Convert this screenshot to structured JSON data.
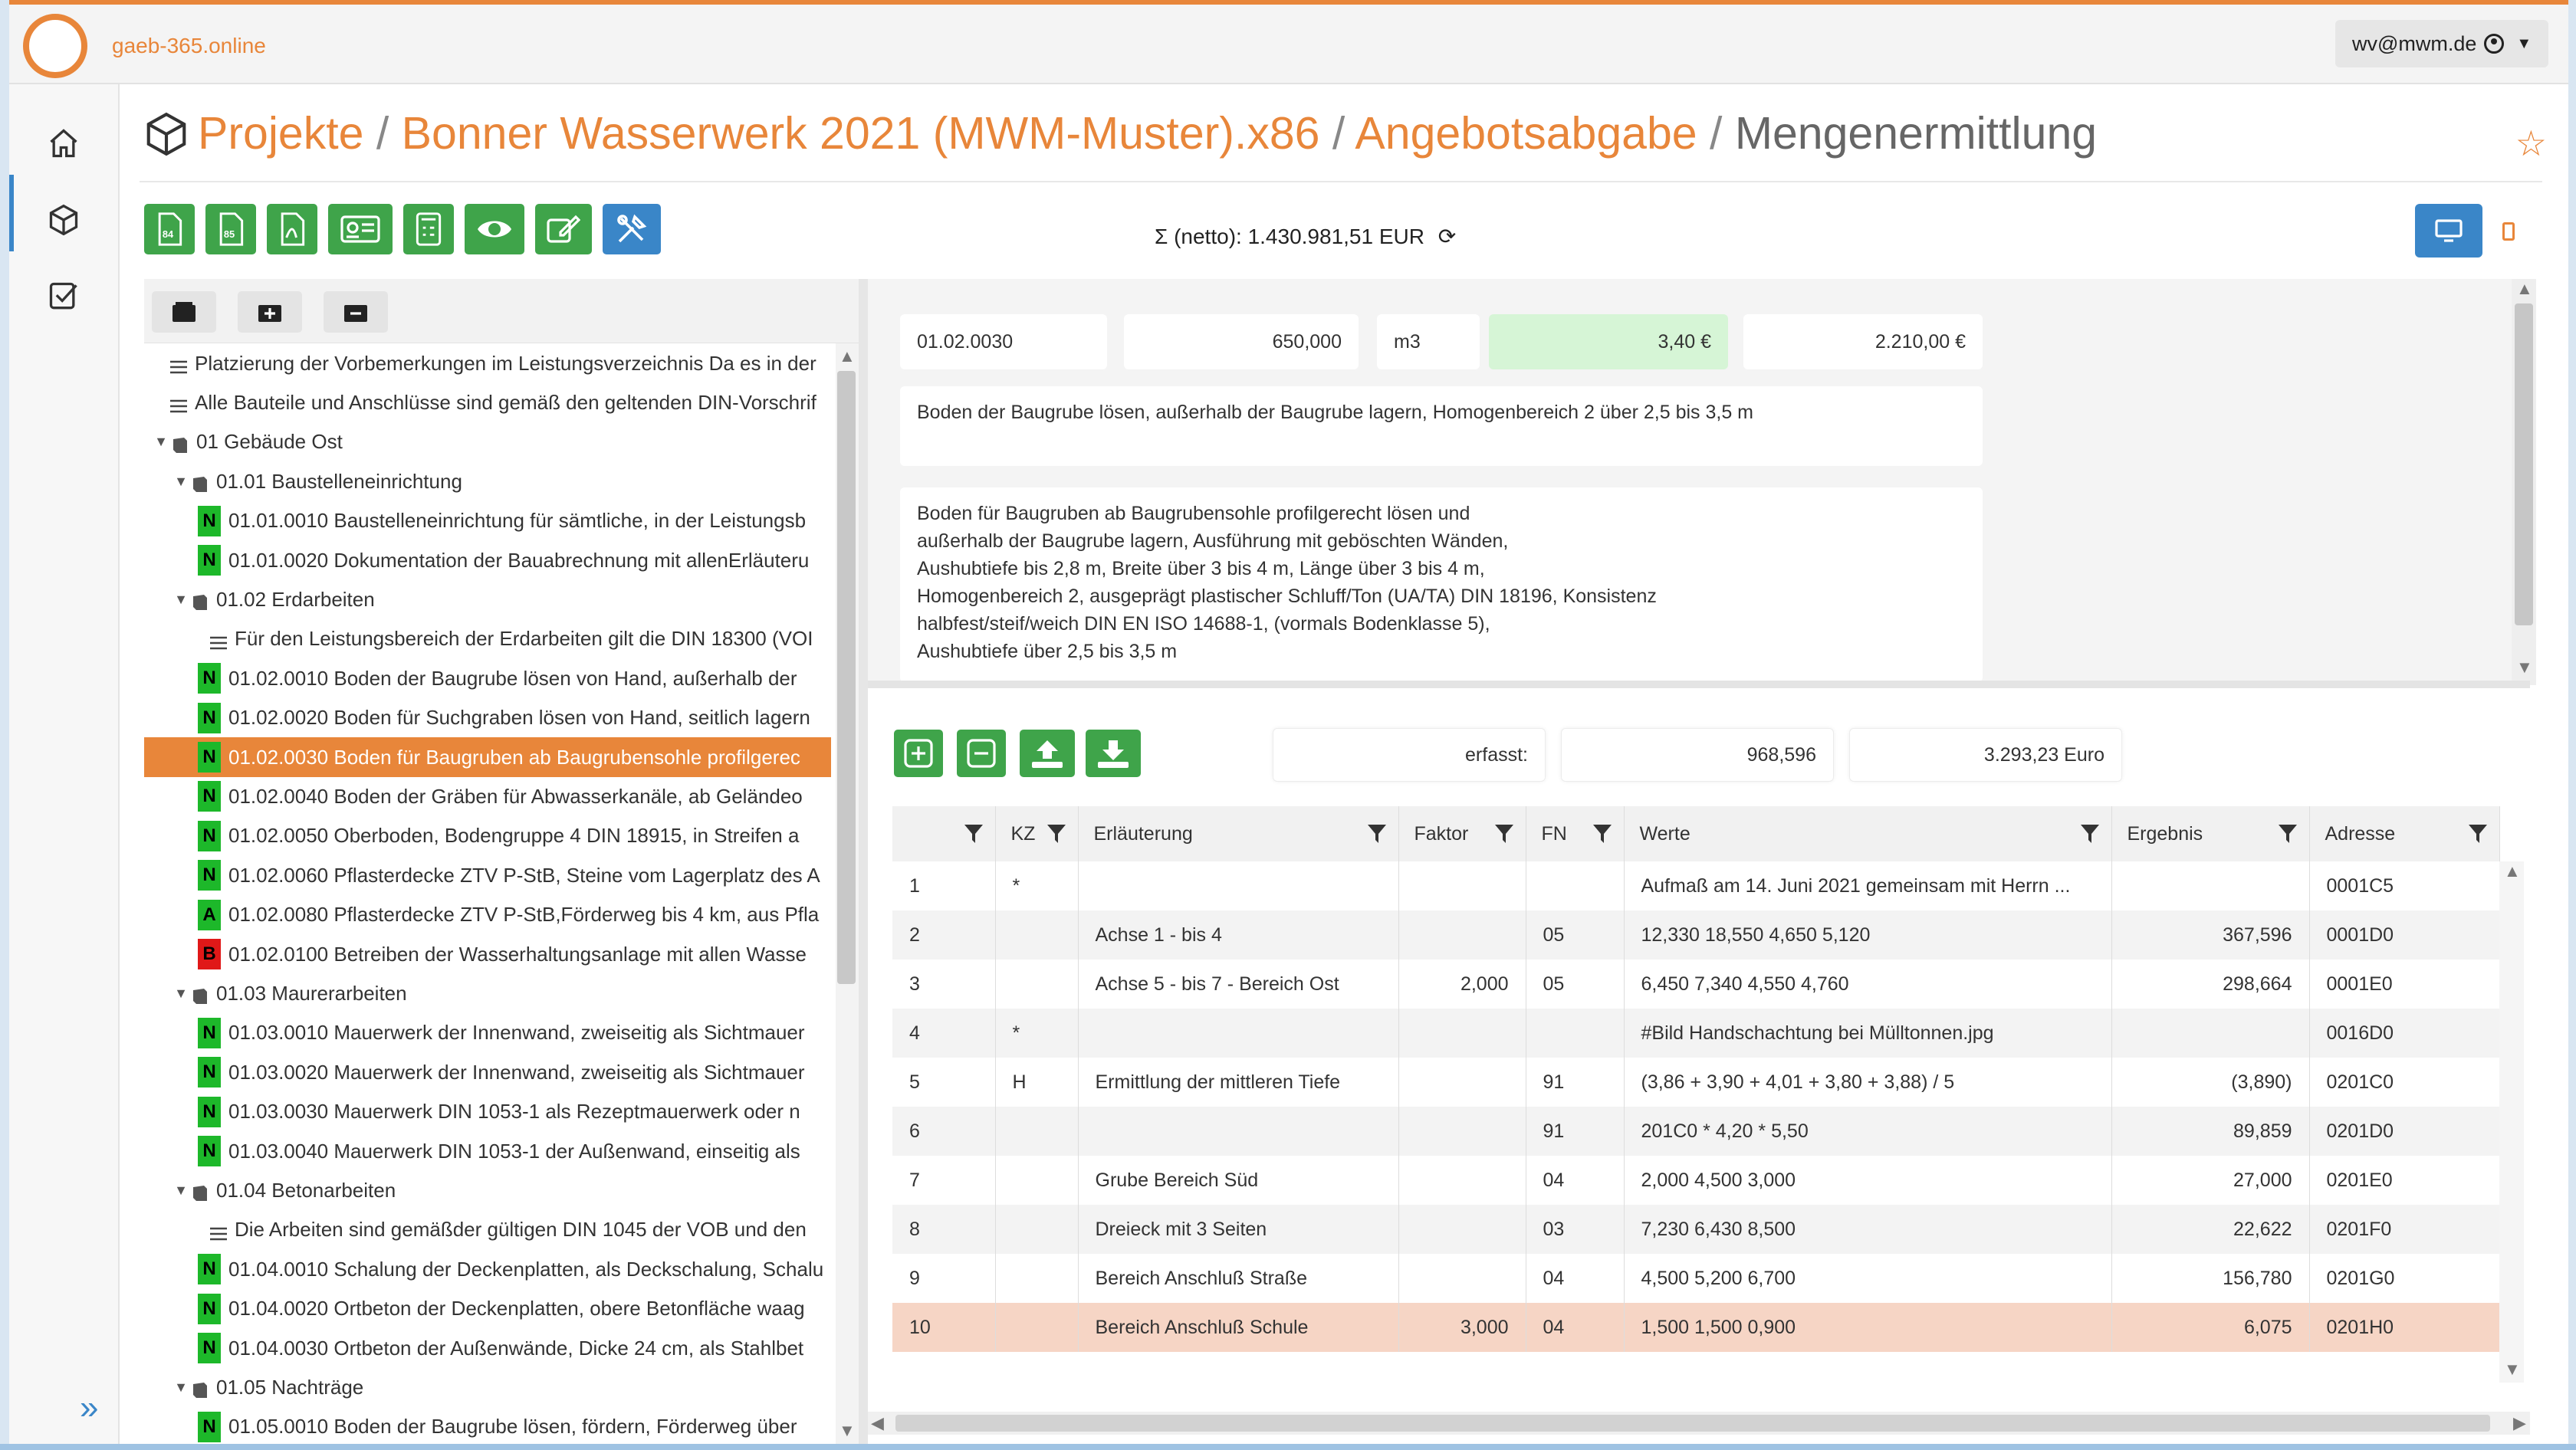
{
  "app": {
    "brand": "gaeb-365.online",
    "user": "wv@mwm.de"
  },
  "breadcrumb": {
    "projects": "Projekte",
    "sep": "/",
    "project": "Bonner Wasserwerk 2021 (MWM-Muster).x86",
    "stage": "Angebotsabgabe",
    "current": "Mengenermittlung"
  },
  "toolbar": {
    "buttons": [
      "84",
      "85",
      "pdf",
      "card",
      "calc",
      "view",
      "edit",
      "tools"
    ],
    "sum_text": "Σ (netto): 1.430.981,51 EUR"
  },
  "tree": {
    "rows": [
      {
        "indent": 0,
        "type": "text",
        "label": "Platzierung der Vorbemerkungen im Leistungsverzeichnis Da es in der"
      },
      {
        "indent": 0,
        "type": "text",
        "label": "Alle Bauteile und Anschlüsse sind gemäß den geltenden DIN-Vorschrif"
      },
      {
        "indent": 0,
        "type": "group",
        "toggle": "▼",
        "label": "01 Gebäude Ost"
      },
      {
        "indent": 1,
        "type": "group",
        "toggle": "▼",
        "label": "01.01 Baustelleneinrichtung"
      },
      {
        "indent": 2,
        "type": "item",
        "badge": "N",
        "label": "01.01.0010 Baustelleneinrichtung für sämtliche, in der Leistungsb"
      },
      {
        "indent": 2,
        "type": "item",
        "badge": "N",
        "label": "01.01.0020 Dokumentation der Bauabrechnung mit allenErläuteru"
      },
      {
        "indent": 1,
        "type": "group",
        "toggle": "▼",
        "label": "01.02 Erdarbeiten"
      },
      {
        "indent": 2,
        "type": "text",
        "label": "Für den Leistungsbereich der Erdarbeiten gilt die DIN 18300 (VOI"
      },
      {
        "indent": 2,
        "type": "item",
        "badge": "N",
        "label": "01.02.0010 Boden der Baugrube lösen von Hand, außerhalb der"
      },
      {
        "indent": 2,
        "type": "item",
        "badge": "N",
        "label": "01.02.0020 Boden für Suchgraben lösen von Hand, seitlich lagern"
      },
      {
        "indent": 2,
        "type": "item",
        "badge": "N",
        "selected": true,
        "label": "01.02.0030 Boden für Baugruben ab Baugrubensohle profilgerec"
      },
      {
        "indent": 2,
        "type": "item",
        "badge": "N",
        "label": "01.02.0040 Boden der Gräben für Abwasserkanäle, ab Geländeo"
      },
      {
        "indent": 2,
        "type": "item",
        "badge": "N",
        "label": "01.02.0050 Oberboden, Bodengruppe 4 DIN 18915, in Streifen a"
      },
      {
        "indent": 2,
        "type": "item",
        "badge": "N",
        "label": "01.02.0060 Pflasterdecke ZTV P-StB, Steine vom Lagerplatz des A"
      },
      {
        "indent": 2,
        "type": "item",
        "badge": "A",
        "label": "01.02.0080 Pflasterdecke ZTV P-StB,Förderweg bis 4 km, aus Pfla"
      },
      {
        "indent": 2,
        "type": "item",
        "badge": "B",
        "label": "01.02.0100 Betreiben der Wasserhaltungsanlage mit allen Wasse"
      },
      {
        "indent": 1,
        "type": "group",
        "toggle": "▼",
        "label": "01.03 Maurerarbeiten"
      },
      {
        "indent": 2,
        "type": "item",
        "badge": "N",
        "label": "01.03.0010 Mauerwerk der Innenwand, zweiseitig als Sichtmauer"
      },
      {
        "indent": 2,
        "type": "item",
        "badge": "N",
        "label": "01.03.0020 Mauerwerk der Innenwand, zweiseitig als Sichtmauer"
      },
      {
        "indent": 2,
        "type": "item",
        "badge": "N",
        "label": "01.03.0030 Mauerwerk DIN 1053-1 als Rezeptmauerwerk oder n"
      },
      {
        "indent": 2,
        "type": "item",
        "badge": "N",
        "label": "01.03.0040 Mauerwerk DIN 1053-1 der Außenwand, einseitig als"
      },
      {
        "indent": 1,
        "type": "group",
        "toggle": "▼",
        "label": "01.04 Betonarbeiten"
      },
      {
        "indent": 2,
        "type": "text",
        "label": "Die Arbeiten sind gemäßder gültigen DIN 1045 der VOB und den"
      },
      {
        "indent": 2,
        "type": "item",
        "badge": "N",
        "label": "01.04.0010 Schalung der Deckenplatten, als Deckschalung, Schalu"
      },
      {
        "indent": 2,
        "type": "item",
        "badge": "N",
        "label": "01.04.0020 Ortbeton der Deckenplatten, obere Betonfläche waag"
      },
      {
        "indent": 2,
        "type": "item",
        "badge": "N",
        "label": "01.04.0030 Ortbeton der Außenwände, Dicke 24 cm, als Stahlbet"
      },
      {
        "indent": 1,
        "type": "group",
        "toggle": "▼",
        "label": "01.05 Nachträge"
      },
      {
        "indent": 2,
        "type": "item",
        "badge": "N",
        "label": "01.05.0010 Boden der Baugrube lösen, fördern, Förderweg über"
      }
    ]
  },
  "position": {
    "oz": "01.02.0030",
    "quantity": "650,000",
    "unit": "m3",
    "unit_price": "3,40 €",
    "total": "2.210,00 €",
    "short_text": "Boden der Baugrube lösen, außerhalb der Baugrube lagern, Homogenbereich 2 über 2,5 bis 3,5 m",
    "long_text": [
      "Boden für Baugruben ab Baugrubensohle profilgerecht lösen und",
      "außerhalb der Baugrube lagern, Ausführung mit geböschten Wänden,",
      "Aushubtiefe bis 2,8 m, Breite über 3 bis 4 m, Länge über 3 bis 4 m,",
      "Homogenbereich 2, ausgeprägt plastischer Schluff/Ton (UA/TA) DIN 18196, Konsistenz",
      "halbfest/steif/weich DIN EN ISO 14688-1, (vormals Bodenklasse 5),",
      "Aushubtiefe über 2,5 bis 3,5 m"
    ]
  },
  "summary": {
    "label": "erfasst:",
    "quantity": "968,596",
    "amount": "3.293,23 Euro"
  },
  "grid": {
    "columns": [
      "",
      "KZ",
      "Erläuterung",
      "Faktor",
      "FN",
      "Werte",
      "Ergebnis",
      "Adresse"
    ],
    "rows": [
      [
        "1",
        "*",
        "",
        "",
        "",
        "Aufmaß am 14. Juni 2021 gemeinsam mit Herrn ...",
        "",
        "0001C5"
      ],
      [
        "2",
        "",
        "Achse 1 - bis 4",
        "",
        "05",
        "12,330 18,550 4,650 5,120",
        "367,596",
        "0001D0"
      ],
      [
        "3",
        "",
        "Achse 5 - bis 7 - Bereich Ost",
        "2,000",
        "05",
        "6,450 7,340 4,550 4,760",
        "298,664",
        "0001E0"
      ],
      [
        "4",
        "*",
        "",
        "",
        "",
        "#Bild Handschachtung bei Mülltonnen.jpg",
        "",
        "0016D0"
      ],
      [
        "5",
        "H",
        "Ermittlung der mittleren Tiefe",
        "",
        "91",
        "(3,86 + 3,90 + 4,01 + 3,80 + 3,88) / 5",
        "(3,890)",
        "0201C0"
      ],
      [
        "6",
        "",
        "",
        "",
        "91",
        "201C0 * 4,20 * 5,50",
        "89,859",
        "0201D0"
      ],
      [
        "7",
        "",
        "Grube Bereich Süd",
        "",
        "04",
        "2,000 4,500 3,000",
        "27,000",
        "0201E0"
      ],
      [
        "8",
        "",
        "Dreieck mit 3 Seiten",
        "",
        "03",
        "7,230 6,430 8,500",
        "22,622",
        "0201F0"
      ],
      [
        "9",
        "",
        "Bereich Anschluß Straße",
        "",
        "04",
        "4,500 5,200 6,700",
        "156,780",
        "0201G0"
      ],
      [
        "10",
        "",
        "Bereich Anschluß Schule",
        "3,000",
        "04",
        "1,500 1,500 0,900",
        "6,075",
        "0201H0"
      ]
    ],
    "highlight_row": 10
  }
}
